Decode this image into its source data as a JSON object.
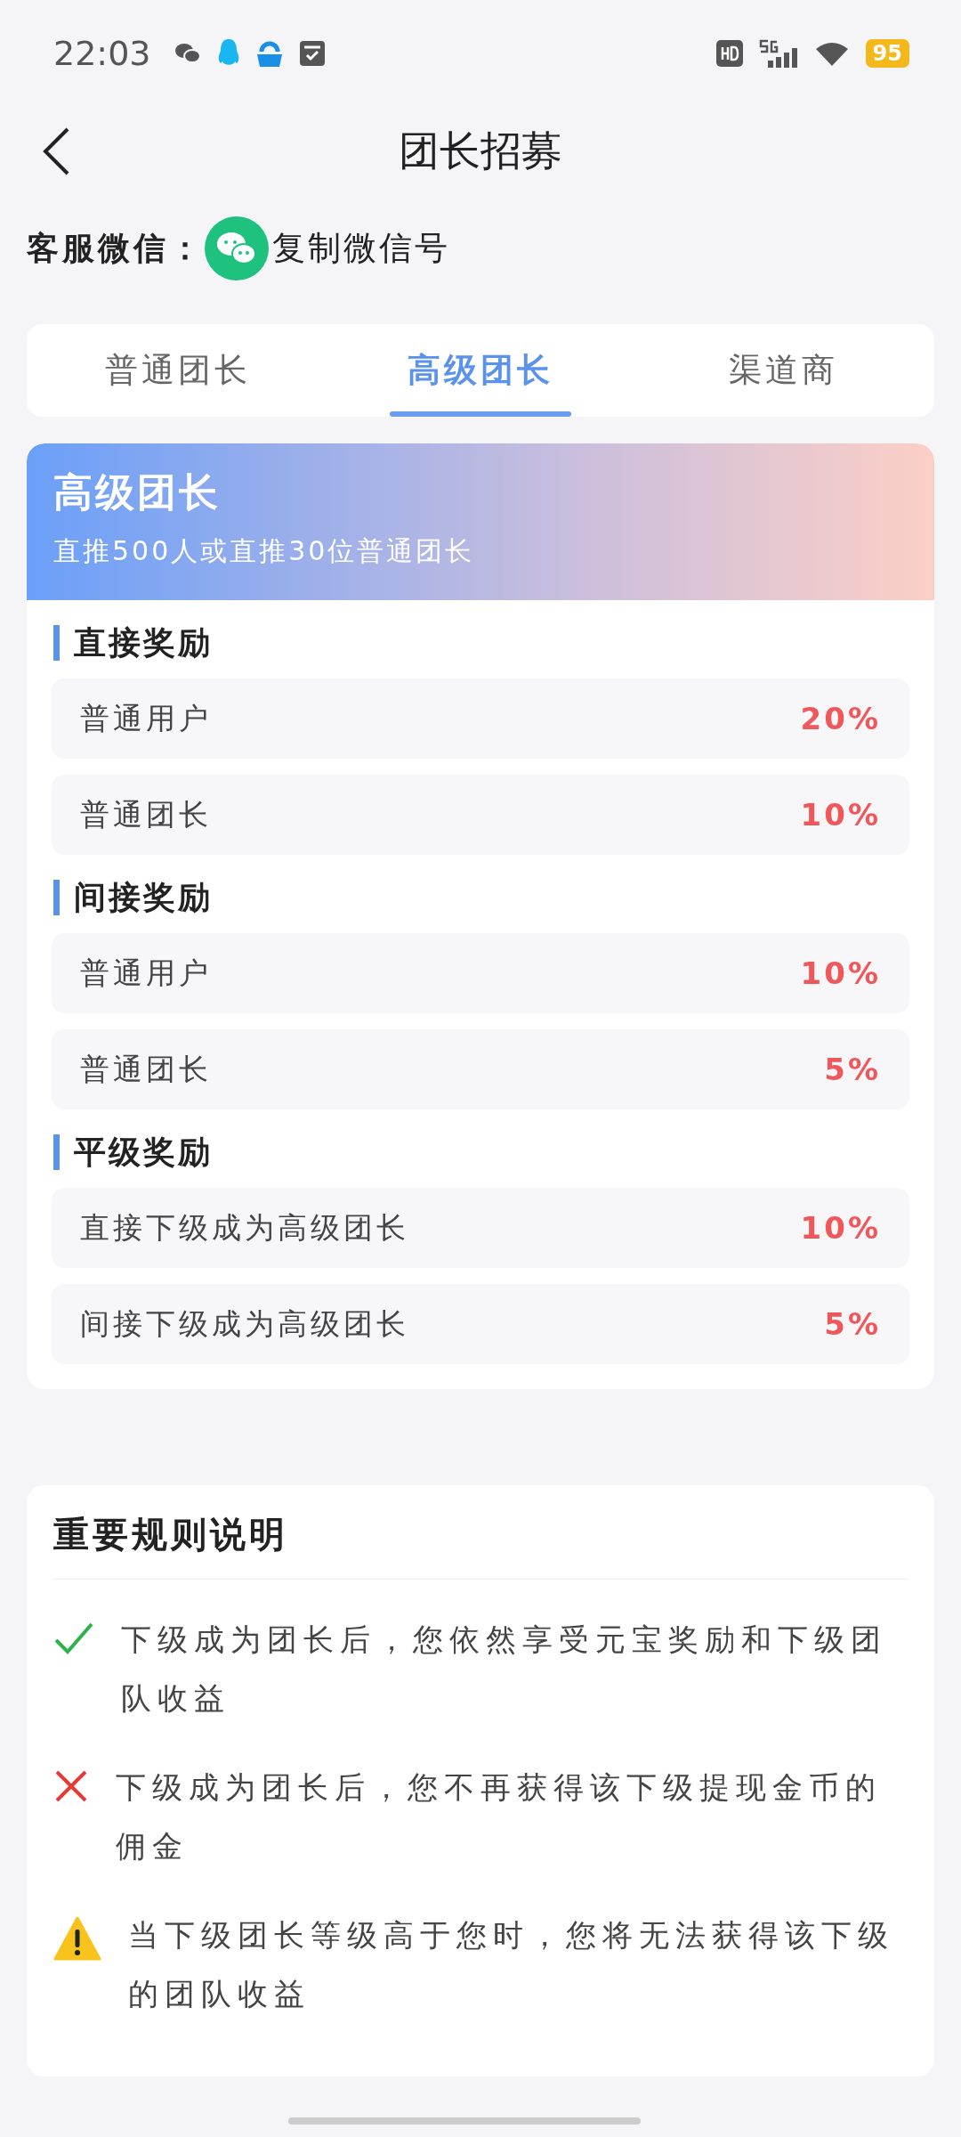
{
  "status_bar": {
    "time": "22:03",
    "battery": "95"
  },
  "header": {
    "title": "团长招募"
  },
  "contact": {
    "label": "客服微信：",
    "action": "复制微信号"
  },
  "tabs": [
    {
      "label": "普通团长",
      "selected": false
    },
    {
      "label": "高级团长",
      "selected": true
    },
    {
      "label": "渠道商",
      "selected": false
    }
  ],
  "level_card": {
    "title": "高级团长",
    "requirement": "直推500人或直推30位普通团长",
    "sections": [
      {
        "title": "直接奖励",
        "rows": [
          {
            "name": "普通用户",
            "value": "20%"
          },
          {
            "name": "普通团长",
            "value": "10%"
          }
        ]
      },
      {
        "title": "间接奖励",
        "rows": [
          {
            "name": "普通用户",
            "value": "10%"
          },
          {
            "name": "普通团长",
            "value": "5%"
          }
        ]
      },
      {
        "title": "平级奖励",
        "rows": [
          {
            "name": "直接下级成为高级团长",
            "value": "10%"
          },
          {
            "name": "间接下级成为高级团长",
            "value": "5%"
          }
        ]
      }
    ]
  },
  "rules": {
    "title": "重要规则说明",
    "items": [
      {
        "kind": "check",
        "text": "下级成为团长后，您依然享受元宝奖励和下级团队收益"
      },
      {
        "kind": "cross",
        "text": "下级成为团长后，您不再获得该下级提现金币的佣金"
      },
      {
        "kind": "warning",
        "text": "当下级团长等级高于您时，您将无法获得该下级的团队收益"
      }
    ]
  }
}
